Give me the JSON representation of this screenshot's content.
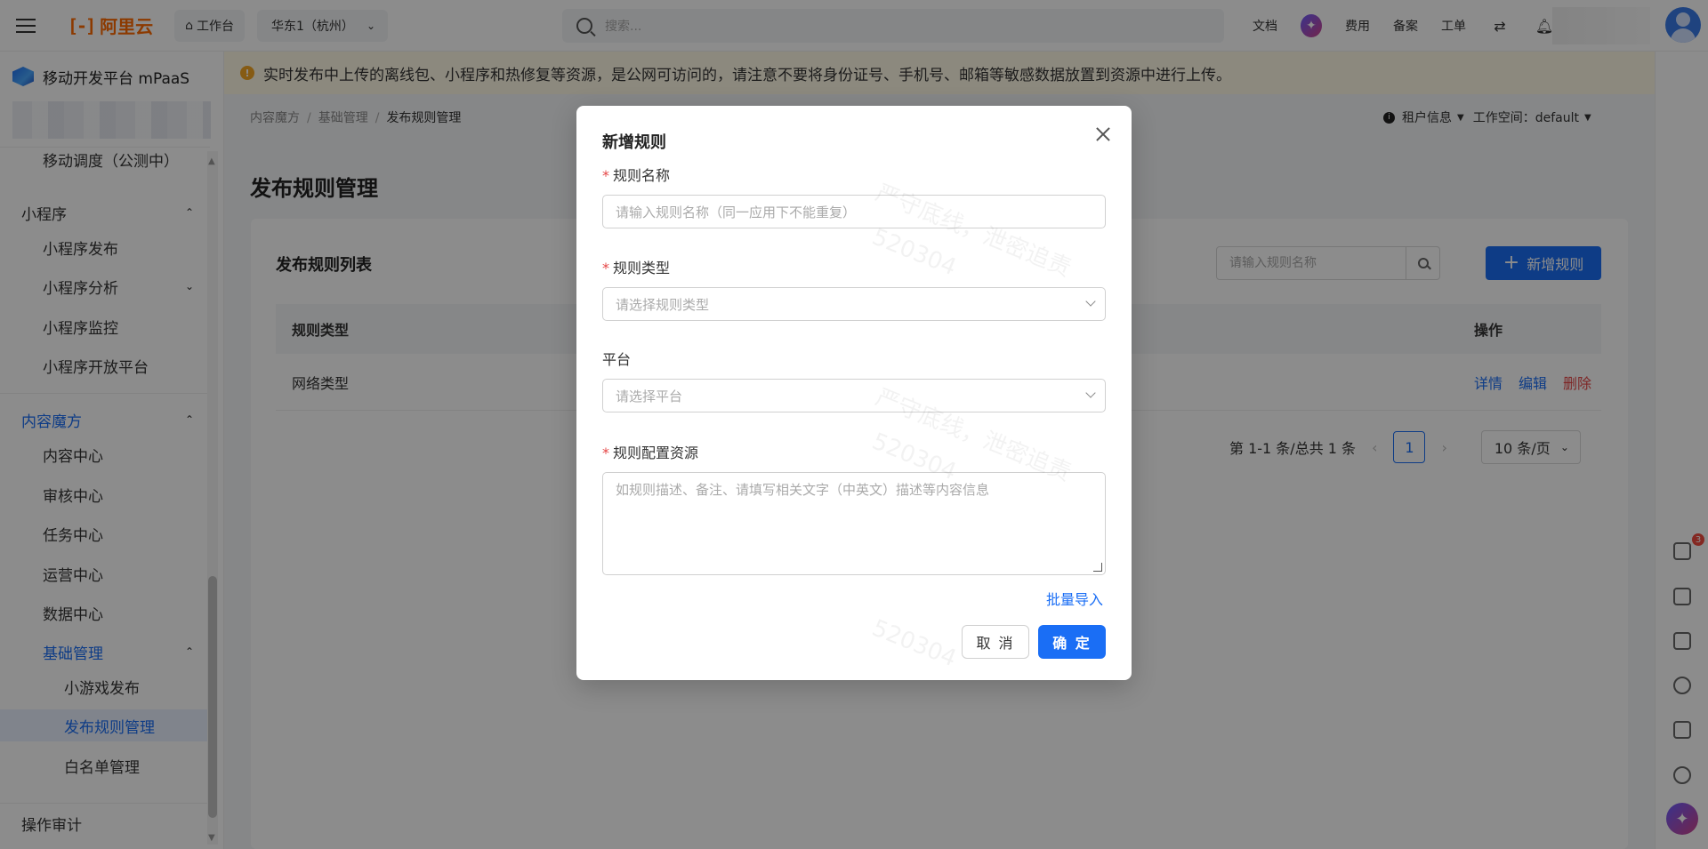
{
  "topbar": {
    "logo_mark": "[-]",
    "logo_text": "阿里云",
    "workbench": "工作台",
    "region": "华东1（杭州）",
    "search_placeholder": "搜索...",
    "links": [
      "文档",
      "费用",
      "备案",
      "工单"
    ]
  },
  "sidebar": {
    "product": "移动开发平台 mPaaS",
    "items": [
      {
        "label": "移动调度（公测中）"
      },
      {
        "label": "小程序"
      },
      {
        "label": "小程序发布"
      },
      {
        "label": "小程序分析"
      },
      {
        "label": "小程序监控"
      },
      {
        "label": "小程序开放平台"
      },
      {
        "label": "内容魔方"
      },
      {
        "label": "内容中心"
      },
      {
        "label": "审核中心"
      },
      {
        "label": "任务中心"
      },
      {
        "label": "运营中心"
      },
      {
        "label": "数据中心"
      },
      {
        "label": "基础管理"
      },
      {
        "label": "小游戏发布"
      },
      {
        "label": "发布规则管理"
      },
      {
        "label": "白名单管理"
      },
      {
        "label": "操作审计"
      }
    ]
  },
  "notice": "实时发布中上传的离线包、小程序和热修复等资源，是公网可访问的，请注意不要将身份证号、手机号、邮箱等敏感数据放置到资源中进行上传。",
  "breadcrumb": [
    "内容魔方",
    "基础管理",
    "发布规则管理"
  ],
  "tenant": {
    "label": "租户信息",
    "workspace": "工作空间：default"
  },
  "page": {
    "title": "发布规则管理",
    "list_title": "发布规则列表",
    "search_placeholder": "请输入规则名称",
    "add_button": "新增规则",
    "columns": [
      "规则类型",
      "操作"
    ],
    "rows": [
      {
        "type": "网络类型",
        "actions": [
          "详情",
          "编辑",
          "删除"
        ]
      }
    ],
    "pagination": {
      "summary": "第 1-1 条/总共 1 条",
      "current_page": "1",
      "page_size": "10 条/页"
    }
  },
  "dock": {
    "badge": "3"
  },
  "modal": {
    "title": "新增规则",
    "fields": [
      {
        "label": "规则名称",
        "required": true,
        "placeholder": "请输入规则名称（同一应用下不能重复）"
      },
      {
        "label": "规则类型",
        "required": true,
        "placeholder": "请选择规则类型"
      },
      {
        "label": "平台",
        "required": false,
        "placeholder": "请选择平台"
      },
      {
        "label": "规则配置资源",
        "required": true,
        "placeholder": "如规则描述、备注、请填写相关文字（中英文）描述等内容信息"
      }
    ],
    "batch_import": "批量导入",
    "cancel": "取 消",
    "ok": "确 定"
  },
  "watermark": [
    "严守底线，泄密追责",
    "520304"
  ],
  "colors": {
    "primary": "#1a6ef5",
    "brand": "#ff6a00",
    "danger": "#e54545",
    "warning_bg": "#fff9e6"
  }
}
